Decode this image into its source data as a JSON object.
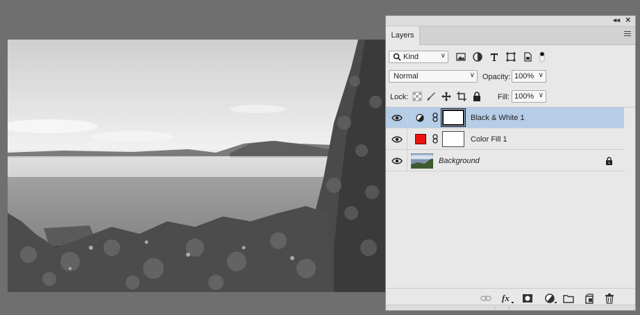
{
  "panel": {
    "tab_label": "Layers",
    "collapse_icon": "double-chevron-left-icon",
    "close_icon": "close-icon"
  },
  "filter": {
    "kind_label": "Kind",
    "filter_icons": [
      "image-filter-icon",
      "adjustment-filter-icon",
      "type-filter-icon",
      "shape-filter-icon",
      "smart-object-filter-icon",
      "filter-toggle-icon"
    ]
  },
  "blend": {
    "mode": "Normal",
    "opacity_label": "Opacity:",
    "opacity_value": "100%"
  },
  "lock": {
    "lock_label": "Lock:",
    "fill_label": "Fill:",
    "fill_value": "100%"
  },
  "layers": [
    {
      "name": "Black & White 1",
      "type": "adjustment",
      "selected": true,
      "visible": true
    },
    {
      "name": "Color Fill 1",
      "type": "fill",
      "fill_color": "#e8140f",
      "selected": false,
      "visible": true
    },
    {
      "name": "Background",
      "type": "image",
      "locked": true,
      "selected": false,
      "visible": true
    }
  ],
  "colors": {
    "selected_row": "#b6cde8",
    "panel_bg": "#e8e8e8",
    "workspace_bg": "#6f6f6f"
  }
}
